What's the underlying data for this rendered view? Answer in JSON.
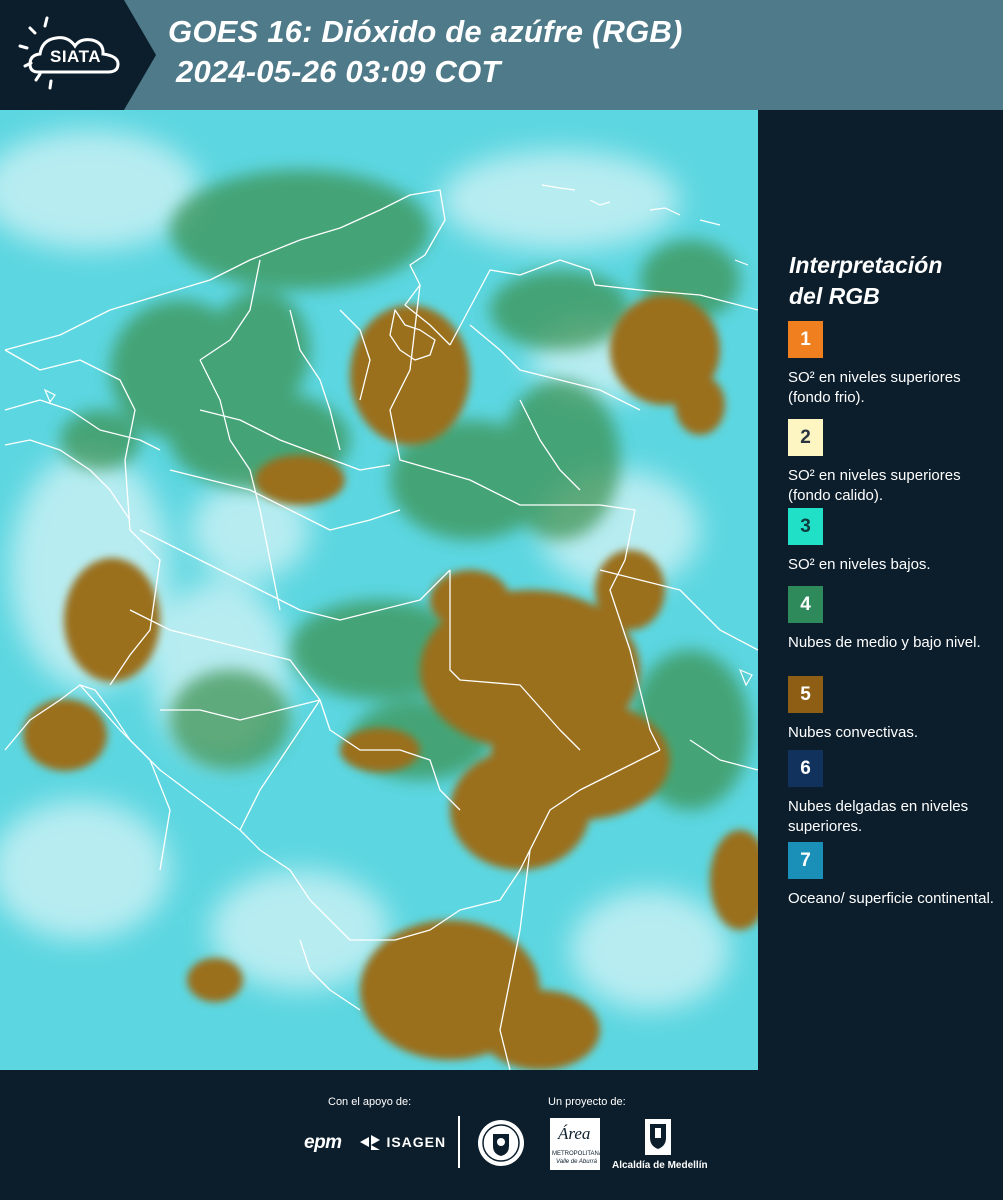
{
  "header": {
    "logo_text": "SIATA",
    "title_line1": "GOES 16: Dióxido de azúfre (RGB)",
    "title_line2": "2024-05-26 03:09 COT"
  },
  "legend": {
    "title_line1": "Interpretación",
    "title_line2": "del RGB",
    "items": [
      {
        "number": "1",
        "text": "SO² en niveles superiores (fondo frio).",
        "color": "#f07f1f",
        "text_color": "#ffffff"
      },
      {
        "number": "2",
        "text": "SO² en niveles superiores (fondo calido).",
        "color": "#fdf6c3",
        "text_color": "#2a3340"
      },
      {
        "number": "3",
        "text": "SO² en niveles bajos.",
        "color": "#20e0c8",
        "text_color": "#0d3b3b"
      },
      {
        "number": "4",
        "text": "Nubes de medio y bajo nivel.",
        "color": "#2e8a5a",
        "text_color": "#ffffff"
      },
      {
        "number": "5",
        "text": "Nubes convectivas.",
        "color": "#8e5e14",
        "text_color": "#ffffff"
      },
      {
        "number": "6",
        "text": "Nubes delgadas en niveles superiores.",
        "color": "#12325e",
        "text_color": "#ffffff"
      },
      {
        "number": "7",
        "text": "Oceano/ superficie continental.",
        "color": "#1a8fb8",
        "text_color": "#ffffff"
      }
    ]
  },
  "footer": {
    "support_label": "Con el apoyo de:",
    "project_label": "Un proyecto de:",
    "logo_epm": "epm",
    "logo_isagen": "ISAGEN",
    "logo_area_name": "Área",
    "logo_area_sub1": "METROPOLITANA",
    "logo_area_sub2": "Valle de Aburrá",
    "logo_alcaldia": "Alcaldía de Medellín"
  },
  "colors": {
    "header_bg": "#4e7a89",
    "panel_bg": "#0c1e2c",
    "map_cyan": "#5cd6e0",
    "map_white": "#d8f5f8",
    "map_green": "#3c8a4c",
    "map_convective": "#9a6f1e"
  }
}
